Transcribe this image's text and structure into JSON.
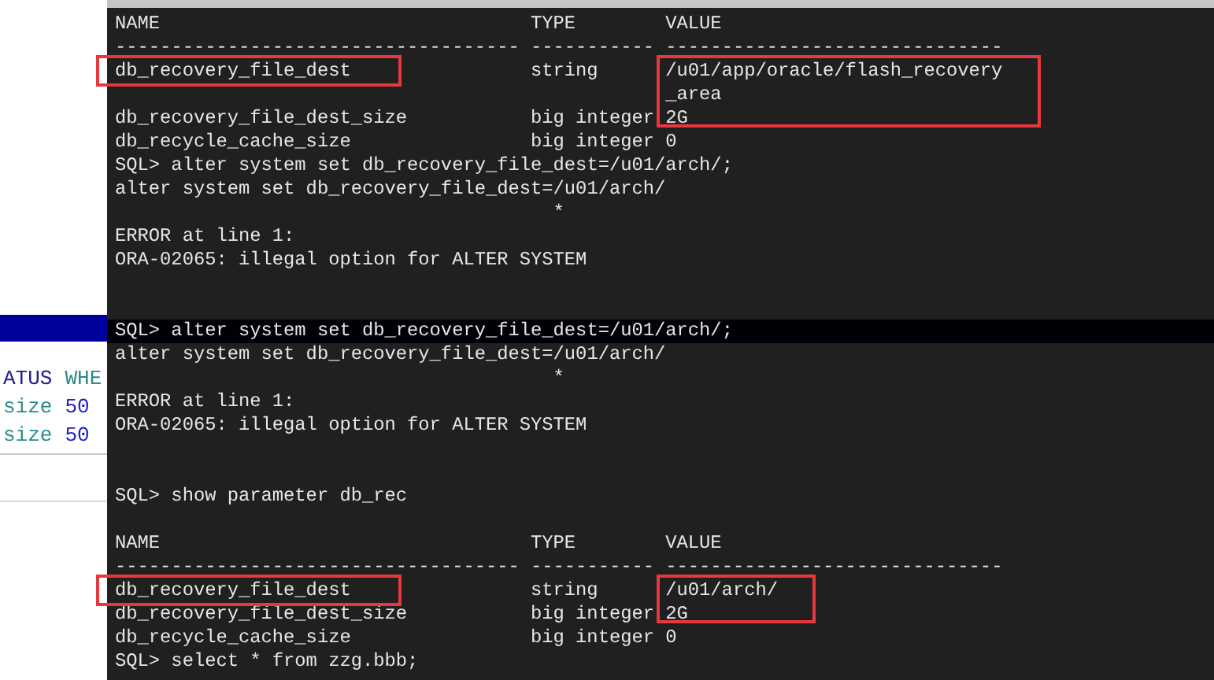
{
  "editor": {
    "lines": [
      {
        "kind": "current_line"
      },
      {
        "kind": "code",
        "segments": [
          {
            "text": "ATUS",
            "color": "#1c1c8c"
          },
          {
            "text": "WHE",
            "color": "#2a8a8a"
          }
        ]
      },
      {
        "kind": "code",
        "segments": [
          {
            "text": "size",
            "color": "#2a8a8a"
          },
          {
            "text": "50",
            "color": "#2020d0"
          }
        ]
      },
      {
        "kind": "code",
        "segments": [
          {
            "text": "size",
            "color": "#2a8a8a"
          },
          {
            "text": "50",
            "color": "#2020d0"
          }
        ]
      }
    ]
  },
  "terminal": {
    "lines": [
      {
        "kind": "header",
        "highlighted": false,
        "columns": [
          "NAME",
          "TYPE",
          "VALUE"
        ]
      },
      {
        "kind": "text",
        "highlighted": false,
        "text": "------------------------------------ ----------- ------------------------------"
      },
      {
        "kind": "row",
        "highlighted": false,
        "name": "db_recovery_file_dest",
        "type": "string",
        "value": "/u01/app/oracle/flash_recovery",
        "name_marked": true,
        "value_marked": true,
        "continuation": [
          "_area"
        ]
      },
      {
        "kind": "row",
        "highlighted": false,
        "name": "db_recovery_file_dest_size",
        "type": "big integer",
        "value": "2G",
        "name_marked": false,
        "value_marked": false
      },
      {
        "kind": "row",
        "highlighted": false,
        "name": "db_recycle_cache_size",
        "type": "big integer",
        "value": "0",
        "name_marked": false,
        "value_marked": false
      },
      {
        "kind": "text",
        "highlighted": false,
        "text": "SQL> alter system set db_recovery_file_dest=/u01/arch/;"
      },
      {
        "kind": "text",
        "highlighted": false,
        "text": "alter system set db_recovery_file_dest=/u01/arch/"
      },
      {
        "kind": "text",
        "highlighted": false,
        "text": "                                       *"
      },
      {
        "kind": "text",
        "highlighted": false,
        "text": "ERROR at line 1:"
      },
      {
        "kind": "text",
        "highlighted": false,
        "text": "ORA-02065: illegal option for ALTER SYSTEM"
      },
      {
        "kind": "blank",
        "highlighted": false
      },
      {
        "kind": "blank",
        "highlighted": false
      },
      {
        "kind": "text",
        "highlighted": true,
        "text": "SQL> alter system set db_recovery_file_dest=/u01/arch/;"
      },
      {
        "kind": "text",
        "highlighted": false,
        "text": "alter system set db_recovery_file_dest=/u01/arch/"
      },
      {
        "kind": "text",
        "highlighted": false,
        "text": "                                       *"
      },
      {
        "kind": "text",
        "highlighted": false,
        "text": "ERROR at line 1:"
      },
      {
        "kind": "text",
        "highlighted": false,
        "text": "ORA-02065: illegal option for ALTER SYSTEM"
      },
      {
        "kind": "blank",
        "highlighted": false
      },
      {
        "kind": "blank",
        "highlighted": false
      },
      {
        "kind": "text",
        "highlighted": false,
        "text": "SQL> show parameter db_rec"
      },
      {
        "kind": "blank",
        "highlighted": false
      },
      {
        "kind": "header",
        "highlighted": false,
        "columns": [
          "NAME",
          "TYPE",
          "VALUE"
        ]
      },
      {
        "kind": "text",
        "highlighted": false,
        "text": "------------------------------------ ----------- ------------------------------"
      },
      {
        "kind": "row",
        "highlighted": false,
        "name": "db_recovery_file_dest",
        "type": "string",
        "value": "/u01/arch/",
        "name_marked": true,
        "value_marked": true
      },
      {
        "kind": "row",
        "highlighted": false,
        "name": "db_recovery_file_dest_size",
        "type": "big integer",
        "value": "2G",
        "name_marked": false,
        "value_marked": false
      },
      {
        "kind": "row",
        "highlighted": false,
        "name": "db_recycle_cache_size",
        "type": "big integer",
        "value": "0",
        "name_marked": false,
        "value_marked": false
      },
      {
        "kind": "text",
        "highlighted": false,
        "text": "SQL> select * from zzg.bbb;"
      }
    ]
  }
}
